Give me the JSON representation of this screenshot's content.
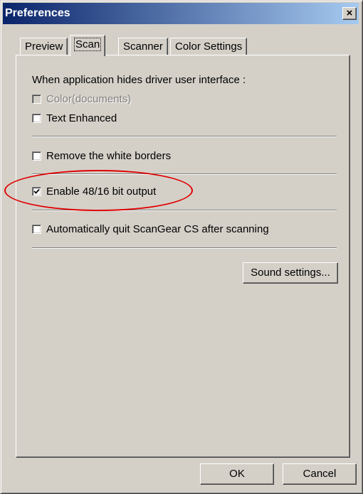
{
  "window": {
    "title": "Preferences",
    "close_label": "×"
  },
  "tabs": [
    {
      "label": "Preview",
      "active": false
    },
    {
      "label": "Scan",
      "active": true
    },
    {
      "label": "Scanner",
      "active": false
    },
    {
      "label": "Color Settings",
      "active": false
    }
  ],
  "scan": {
    "intro": "When application hides driver user interface :",
    "options": [
      {
        "label": "Color(documents)",
        "checked": false,
        "disabled": true
      },
      {
        "label": "Text Enhanced",
        "checked": false,
        "disabled": false
      },
      {
        "label": "Remove the white borders",
        "checked": false,
        "disabled": false
      },
      {
        "label": "Enable 48/16 bit output",
        "checked": true,
        "disabled": false
      },
      {
        "label": "Automatically quit ScanGear CS after scanning",
        "checked": false,
        "disabled": false
      }
    ],
    "sound_button": "Sound settings..."
  },
  "footer": {
    "ok_label": "OK",
    "cancel_label": "Cancel"
  },
  "annotation": {
    "color": "#e00000"
  }
}
